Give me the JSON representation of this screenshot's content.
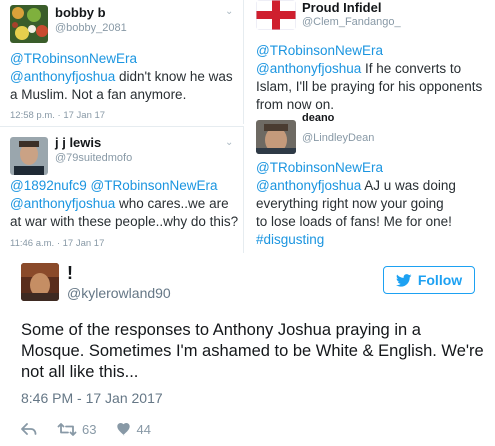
{
  "tweets": [
    {
      "name": "bobby b",
      "handle": "@bobby_2081",
      "reply_to_line": "@TRobinsonNewEra",
      "text_mention": "@anthonyfjoshua",
      "text_line1_rest": " didn't know he was",
      "text_line2": "a Muslim. Not a fan  anymore.",
      "meta": "12:58 p.m. · 17 Jan 17"
    },
    {
      "name": "Proud Infidel",
      "handle": "@Clem_Fandango_",
      "reply_to_line": "@TRobinsonNewEra",
      "text_mention": "@anthonyfjoshua",
      "text_line1_rest": " If he converts to",
      "text_line2": "Islam, I'll be praying for his opponents",
      "text_line3": "from now on."
    },
    {
      "name": "j j lewis",
      "handle": "@79suitedmofo",
      "mention1": "@1892nufc9",
      "mention2": "@TRobinsonNewEra",
      "text_mention": "@anthonyfjoshua",
      "text_line2_rest": " who cares..we are",
      "text_line3": "at war with these people..why do this?",
      "meta": "11:46 a.m. · 17 Jan 17"
    },
    {
      "name": "deano",
      "handle": "@LindleyDean",
      "reply_to_line": "@TRobinsonNewEra",
      "text_mention": "@anthonyfjoshua",
      "text_line1_rest": " AJ u was doing",
      "text_line2": "everything right now your going",
      "text_line3": "to lose loads of fans! Me for one!",
      "hashtag": "#disgusting"
    }
  ],
  "main_tweet": {
    "name": "!",
    "handle": "@kylerowland90",
    "follow_label": "Follow",
    "text": "Some of the responses to Anthony Joshua praying in a Mosque. Sometimes I'm ashamed to be White & English. We're not all like this...",
    "timestamp": "8:46 PM - 17 Jan 2017",
    "retweets": "63",
    "likes": "44"
  },
  "colors": {
    "link": "#1b95e0",
    "accent": "#1da1f2",
    "muted": "#8899a6",
    "like": "#8899a6"
  }
}
